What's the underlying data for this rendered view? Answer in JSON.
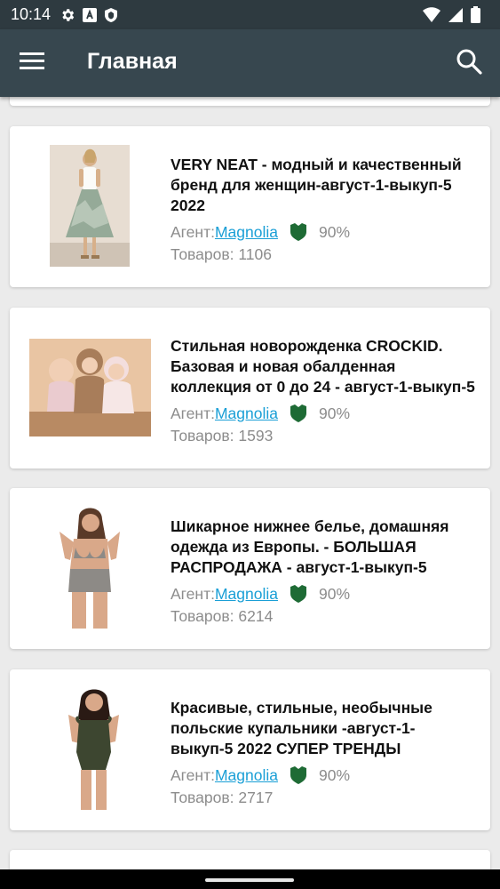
{
  "status_bar": {
    "time": "10:14",
    "left_icons": [
      "gear-icon",
      "font-a-icon",
      "shield-status-icon"
    ],
    "right_icons": [
      "wifi-icon",
      "signal-icon",
      "battery-icon"
    ]
  },
  "app_bar": {
    "title": "Главная",
    "menu_icon": "hamburger-menu-icon",
    "search_icon": "search-icon",
    "color": "#37474f"
  },
  "feed": {
    "agent_prefix": "Агент:",
    "count_prefix": "Товаров: ",
    "link_color": "#1a9fd6",
    "shield_color": "#1e6b35",
    "items": [
      {
        "title": "VERY NEAT - модный и качественный бренд для женщин-август-1-выкуп-5 2022",
        "agent": "Magnolia",
        "rating": "90%",
        "count": "1106",
        "image": "woman in green floral skirt"
      },
      {
        "title": "Стильная новорожденка CROCKID. Базовая и новая обалденная коллекция от 0 до 24 - август-1-выкуп-5",
        "agent": "Magnolia",
        "rating": "90%",
        "count": "1593",
        "image": "three babies sitting"
      },
      {
        "title": "Шикарное нижнее белье, домашняя одежда из Европы. - БОЛЬШАЯ РАСПРОДАЖА - август-1-выкуп-5",
        "agent": "Magnolia",
        "rating": "90%",
        "count": "6214",
        "image": "woman in lingerie"
      },
      {
        "title": "Красивые, стильные, необычные польские купальники -август-1-выкуп-5 2022 СУПЕР ТРЕНДЫ",
        "agent": "Magnolia",
        "rating": "90%",
        "count": "2717",
        "image": "woman in dark green swimsuit"
      }
    ]
  }
}
